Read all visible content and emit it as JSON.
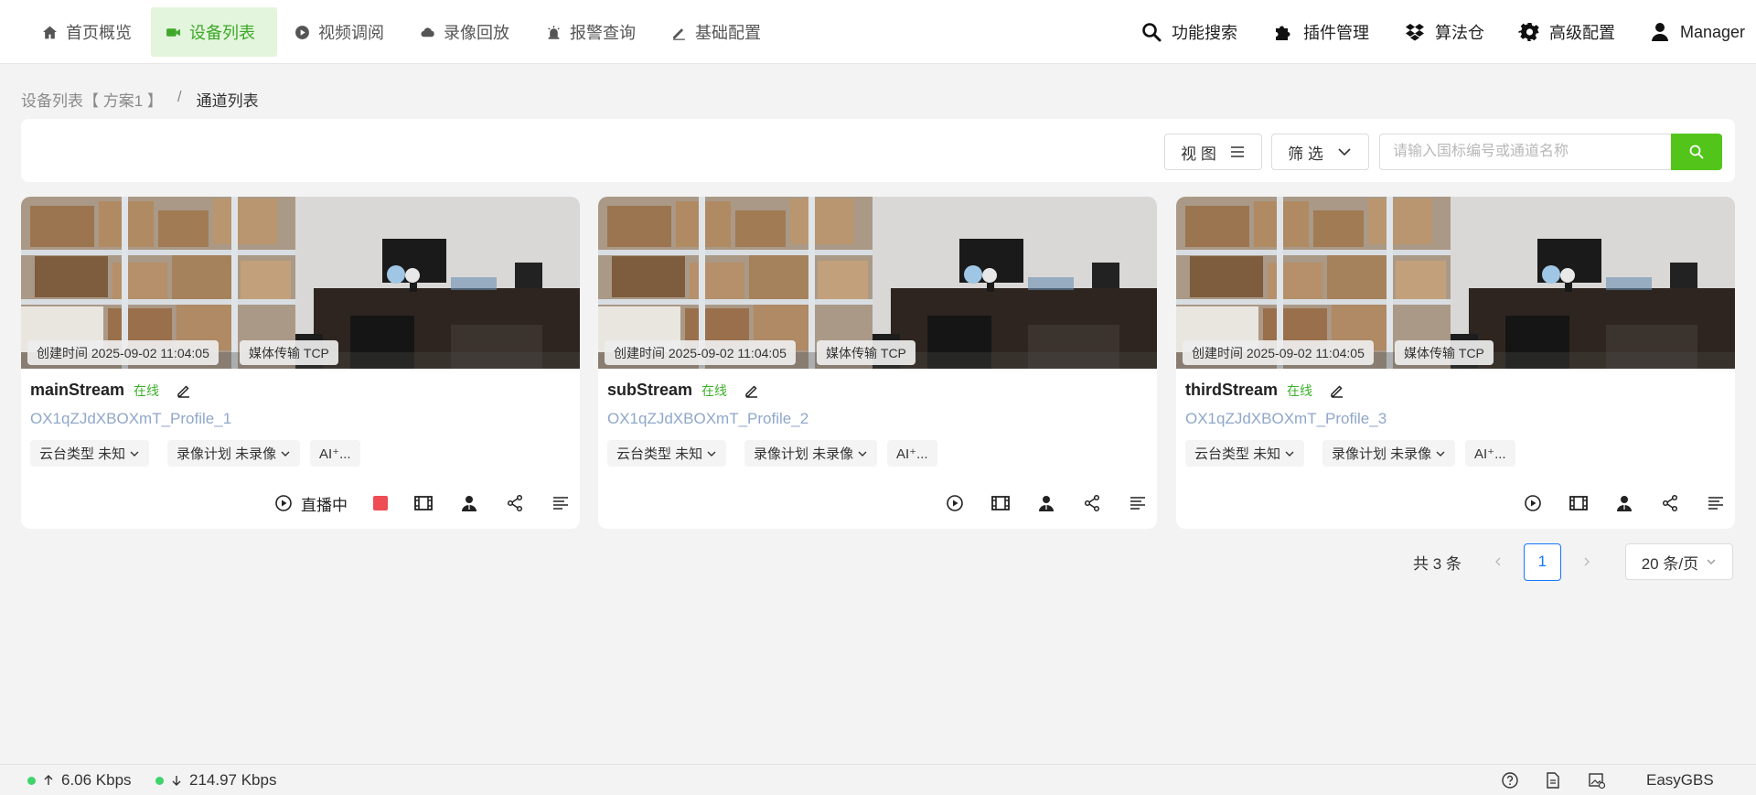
{
  "nav": {
    "items": [
      {
        "label": "首页概览",
        "icon": "home-icon"
      },
      {
        "label": "设备列表",
        "icon": "video-camera-icon",
        "active": true
      },
      {
        "label": "视频调阅",
        "icon": "play-circle-icon"
      },
      {
        "label": "录像回放",
        "icon": "cloud-icon"
      },
      {
        "label": "报警查询",
        "icon": "alarm-icon"
      },
      {
        "label": "基础配置",
        "icon": "pen-icon"
      }
    ],
    "tools": [
      {
        "label": "功能搜索",
        "icon": "search-icon"
      },
      {
        "label": "插件管理",
        "icon": "puzzle-icon"
      },
      {
        "label": "算法仓",
        "icon": "dropbox-icon"
      },
      {
        "label": "高级配置",
        "icon": "gear-icon"
      },
      {
        "label": "Manager",
        "icon": "user-icon"
      }
    ]
  },
  "breadcrumb": {
    "parent": "设备列表【 方案1 】",
    "separator": "/",
    "current": "通道列表"
  },
  "toolbar": {
    "view_label": "视 图",
    "filter_label": "筛 选",
    "search_placeholder": "请输入国标编号或通道名称"
  },
  "cards": [
    {
      "name": "mainStream",
      "status": "在线",
      "profile": "OX1qZJdXBOXmT_Profile_1",
      "created": "创建时间 2025-09-02 11:04:05",
      "transport": "媒体传输 TCP",
      "ptz": "云台类型 未知",
      "record": "录像计划 未录像",
      "ai": "AI⁺...",
      "live_label": "直播中",
      "live": true
    },
    {
      "name": "subStream",
      "status": "在线",
      "profile": "OX1qZJdXBOXmT_Profile_2",
      "created": "创建时间 2025-09-02 11:04:05",
      "transport": "媒体传输 TCP",
      "ptz": "云台类型 未知",
      "record": "录像计划 未录像",
      "ai": "AI⁺...",
      "live": false
    },
    {
      "name": "thirdStream",
      "status": "在线",
      "profile": "OX1qZJdXBOXmT_Profile_3",
      "created": "创建时间 2025-09-02 11:04:05",
      "transport": "媒体传输 TCP",
      "ptz": "云台类型 未知",
      "record": "录像计划 未录像",
      "ai": "AI⁺...",
      "live": false
    }
  ],
  "pagination": {
    "total": "共 3 条",
    "page": "1",
    "page_size": "20 条/页"
  },
  "footer": {
    "upload": "6.06 Kbps",
    "download": "214.97 Kbps",
    "brand": "EasyGBS",
    "icons": [
      "help-icon",
      "document-icon",
      "image-settings-icon"
    ]
  },
  "colors": {
    "accent": "#52c41a",
    "active_bg": "#e3f5dc",
    "online": "#3cb02a",
    "link": "#8fa7c9",
    "page_active": "#1677ff",
    "record_red": "#ee4d55"
  }
}
